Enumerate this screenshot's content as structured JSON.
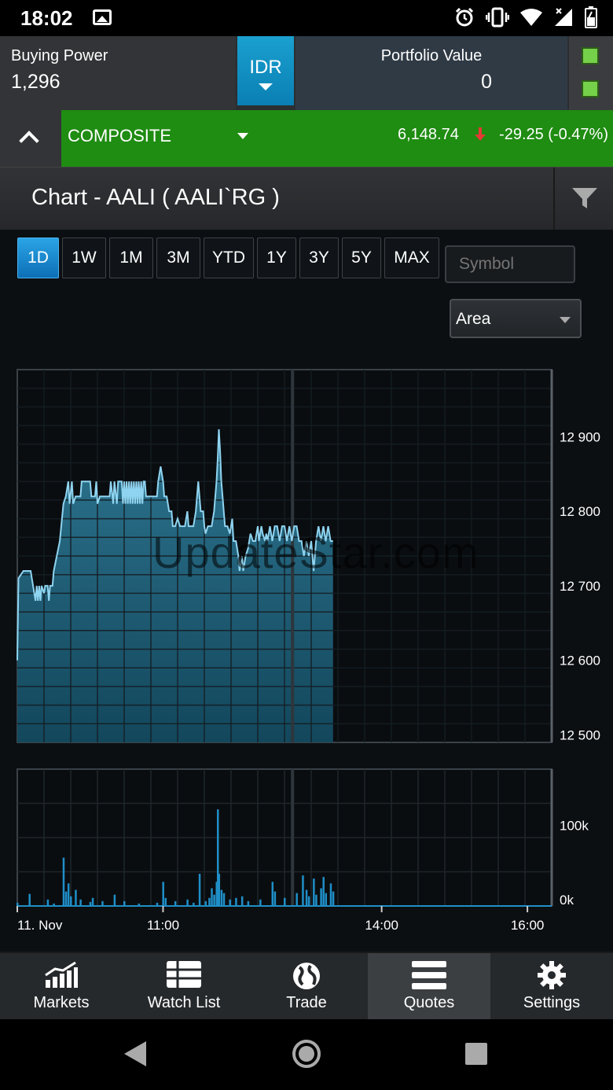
{
  "statusbar": {
    "time": "18:02"
  },
  "header": {
    "buying_power_label": "Buying Power",
    "buying_power_value": "1,296",
    "currency": "IDR",
    "portfolio_label": "Portfolio Value",
    "portfolio_value": "0"
  },
  "ticker": {
    "name": "COMPOSITE",
    "last": "6,148.74",
    "change": "-29.25 (-0.47%)",
    "direction": "down",
    "up_color": "#1f8c12",
    "down_arrow_color": "#e53935"
  },
  "chart_title": "Chart - AALI ( AALI`RG )",
  "range_buttons": [
    "1D",
    "1W",
    "1M",
    "3M",
    "YTD",
    "1Y",
    "3Y",
    "5Y",
    "MAX"
  ],
  "active_range": "1D",
  "symbol_placeholder": "Symbol",
  "chart_type": "Area",
  "watermark": "UpdateStar.com",
  "chart_data": {
    "type": "area",
    "price_y_ticks": [
      "12 900",
      "12 800",
      "12 700",
      "12 600",
      "12 500"
    ],
    "price_ylim": [
      12490,
      12990
    ],
    "volume_y_ticks": [
      "100k",
      "0k"
    ],
    "volume_ylim": [
      0,
      170000
    ],
    "x_tick_labels": [
      "11. Nov",
      "11:00",
      "14:00",
      "16:00"
    ],
    "x_ticks_time": [
      "09:00",
      "11:00",
      "14:00",
      "16:00"
    ],
    "x_range": [
      "09:00",
      "16:20"
    ],
    "price": [
      [
        "09:00",
        12600
      ],
      [
        "09:01",
        12710
      ],
      [
        "09:05",
        12720
      ],
      [
        "09:11",
        12720
      ],
      [
        "09:14",
        12690
      ],
      [
        "09:15",
        12680
      ],
      [
        "09:16",
        12700
      ],
      [
        "09:17",
        12680
      ],
      [
        "09:18",
        12700
      ],
      [
        "09:19",
        12680
      ],
      [
        "09:20",
        12700
      ],
      [
        "09:22",
        12690
      ],
      [
        "09:23",
        12700
      ],
      [
        "09:25",
        12700
      ],
      [
        "09:26",
        12680
      ],
      [
        "09:27",
        12700
      ],
      [
        "09:29",
        12700
      ],
      [
        "09:30",
        12720
      ],
      [
        "09:35",
        12760
      ],
      [
        "09:38",
        12810
      ],
      [
        "09:40",
        12820
      ],
      [
        "09:42",
        12840
      ],
      [
        "09:43",
        12810
      ],
      [
        "09:45",
        12840
      ],
      [
        "09:46",
        12810
      ],
      [
        "09:48",
        12820
      ],
      [
        "09:52",
        12820
      ],
      [
        "09:53",
        12840
      ],
      [
        "10:00",
        12840
      ],
      [
        "10:01",
        12820
      ],
      [
        "10:04",
        12820
      ],
      [
        "10:05",
        12840
      ],
      [
        "10:06",
        12810
      ],
      [
        "10:08",
        12820
      ],
      [
        "10:16",
        12820
      ],
      [
        "10:17",
        12840
      ],
      [
        "10:19",
        12810
      ],
      [
        "10:20",
        12840
      ],
      [
        "10:22",
        12810
      ],
      [
        "10:23",
        12840
      ],
      [
        "10:26",
        12840
      ],
      [
        "10:27",
        12810
      ],
      [
        "10:28",
        12840
      ],
      [
        "10:29",
        12810
      ],
      [
        "10:30",
        12840
      ],
      [
        "10:31",
        12810
      ],
      [
        "10:32",
        12840
      ],
      [
        "10:33",
        12810
      ],
      [
        "10:34",
        12840
      ],
      [
        "10:35",
        12810
      ],
      [
        "10:36",
        12840
      ],
      [
        "10:37",
        12810
      ],
      [
        "10:38",
        12840
      ],
      [
        "10:39",
        12810
      ],
      [
        "10:40",
        12840
      ],
      [
        "10:41",
        12810
      ],
      [
        "10:42",
        12840
      ],
      [
        "10:43",
        12810
      ],
      [
        "10:44",
        12840
      ],
      [
        "10:45",
        12840
      ],
      [
        "10:46",
        12820
      ],
      [
        "10:55",
        12820
      ],
      [
        "10:56",
        12840
      ],
      [
        "10:58",
        12860
      ],
      [
        "11:00",
        12840
      ],
      [
        "11:01",
        12820
      ],
      [
        "11:03",
        12820
      ],
      [
        "11:05",
        12800
      ],
      [
        "11:07",
        12800
      ],
      [
        "11:08",
        12780
      ],
      [
        "11:10",
        12780
      ],
      [
        "11:12",
        12790
      ],
      [
        "11:14",
        12780
      ],
      [
        "11:16",
        12780
      ],
      [
        "11:18",
        12780
      ],
      [
        "11:20",
        12800
      ],
      [
        "11:21",
        12780
      ],
      [
        "11:25",
        12780
      ],
      [
        "11:27",
        12800
      ],
      [
        "11:28",
        12820
      ],
      [
        "11:29",
        12840
      ],
      [
        "11:30",
        12820
      ],
      [
        "11:31",
        12800
      ],
      [
        "11:33",
        12800
      ],
      [
        "11:34",
        12780
      ],
      [
        "11:35",
        12770
      ],
      [
        "11:37",
        12780
      ],
      [
        "11:40",
        12780
      ],
      [
        "11:42",
        12800
      ],
      [
        "11:44",
        12840
      ],
      [
        "11:45",
        12870
      ],
      [
        "11:46",
        12910
      ],
      [
        "11:47",
        12880
      ],
      [
        "11:48",
        12840
      ],
      [
        "11:49",
        12820
      ],
      [
        "11:50",
        12800
      ],
      [
        "11:51",
        12780
      ],
      [
        "11:53",
        12780
      ],
      [
        "11:55",
        12770
      ],
      [
        "11:57",
        12790
      ],
      [
        "11:58",
        12760
      ],
      [
        "12:00",
        12760
      ],
      [
        "12:02",
        12740
      ],
      [
        "12:03",
        12720
      ],
      [
        "12:05",
        12740
      ],
      [
        "12:06",
        12720
      ],
      [
        "12:08",
        12740
      ],
      [
        "12:10",
        12750
      ],
      [
        "12:12",
        12770
      ],
      [
        "12:14",
        12760
      ],
      [
        "12:16",
        12760
      ],
      [
        "12:18",
        12780
      ],
      [
        "12:19",
        12760
      ],
      [
        "12:21",
        12780
      ],
      [
        "12:22",
        12770
      ],
      [
        "12:24",
        12760
      ],
      [
        "12:25",
        12770
      ],
      [
        "12:26",
        12760
      ],
      [
        "12:28",
        12780
      ],
      [
        "12:30",
        12760
      ],
      [
        "12:32",
        12780
      ],
      [
        "12:34",
        12780
      ],
      [
        "12:36",
        12760
      ],
      [
        "12:38",
        12780
      ],
      [
        "12:40",
        12780
      ],
      [
        "12:42",
        12760
      ],
      [
        "12:44",
        12780
      ],
      [
        "12:46",
        12760
      ],
      [
        "12:48",
        12780
      ],
      [
        "12:50",
        12780
      ],
      [
        "12:52",
        12760
      ],
      [
        "12:54",
        12760
      ],
      [
        "12:56",
        12740
      ],
      [
        "12:58",
        12760
      ],
      [
        "13:00",
        12740
      ],
      [
        "13:02",
        12760
      ],
      [
        "13:04",
        12720
      ],
      [
        "13:06",
        12760
      ],
      [
        "13:08",
        12780
      ],
      [
        "13:10",
        12760
      ],
      [
        "13:12",
        12780
      ],
      [
        "13:14",
        12760
      ],
      [
        "13:16",
        12780
      ],
      [
        "13:18",
        12760
      ],
      [
        "13:20",
        12760
      ]
    ],
    "volume": [
      [
        "09:00",
        4000
      ],
      [
        "09:10",
        15000
      ],
      [
        "09:25",
        8000
      ],
      [
        "09:30",
        3000
      ],
      [
        "09:38",
        60000
      ],
      [
        "09:40",
        18000
      ],
      [
        "09:42",
        28000
      ],
      [
        "09:44",
        12000
      ],
      [
        "09:48",
        20000
      ],
      [
        "09:52",
        8000
      ],
      [
        "10:00",
        5000
      ],
      [
        "10:02",
        10000
      ],
      [
        "10:10",
        6000
      ],
      [
        "10:20",
        14000
      ],
      [
        "10:28",
        6000
      ],
      [
        "10:40",
        3000
      ],
      [
        "10:55",
        4000
      ],
      [
        "11:00",
        30000
      ],
      [
        "11:02",
        10000
      ],
      [
        "11:10",
        6000
      ],
      [
        "11:20",
        8000
      ],
      [
        "11:25",
        4000
      ],
      [
        "11:30",
        40000
      ],
      [
        "11:35",
        6000
      ],
      [
        "11:38",
        10000
      ],
      [
        "11:40",
        22000
      ],
      [
        "11:42",
        14000
      ],
      [
        "11:44",
        30000
      ],
      [
        "11:45",
        120000
      ],
      [
        "11:46",
        40000
      ],
      [
        "11:48",
        20000
      ],
      [
        "11:50",
        16000
      ],
      [
        "11:55",
        8000
      ],
      [
        "12:00",
        10000
      ],
      [
        "12:05",
        12000
      ],
      [
        "12:10",
        6000
      ],
      [
        "12:20",
        8000
      ],
      [
        "12:30",
        30000
      ],
      [
        "12:32",
        18000
      ],
      [
        "12:40",
        10000
      ],
      [
        "12:50",
        16000
      ],
      [
        "12:55",
        38000
      ],
      [
        "12:58",
        20000
      ],
      [
        "13:00",
        12000
      ],
      [
        "13:04",
        34000
      ],
      [
        "13:06",
        14000
      ],
      [
        "13:10",
        22000
      ],
      [
        "13:12",
        36000
      ],
      [
        "13:14",
        16000
      ],
      [
        "13:18",
        28000
      ],
      [
        "13:20",
        18000
      ]
    ]
  },
  "bottom_nav": [
    "Markets",
    "Watch List",
    "Trade",
    "Quotes",
    "Settings"
  ],
  "active_nav": "Quotes"
}
